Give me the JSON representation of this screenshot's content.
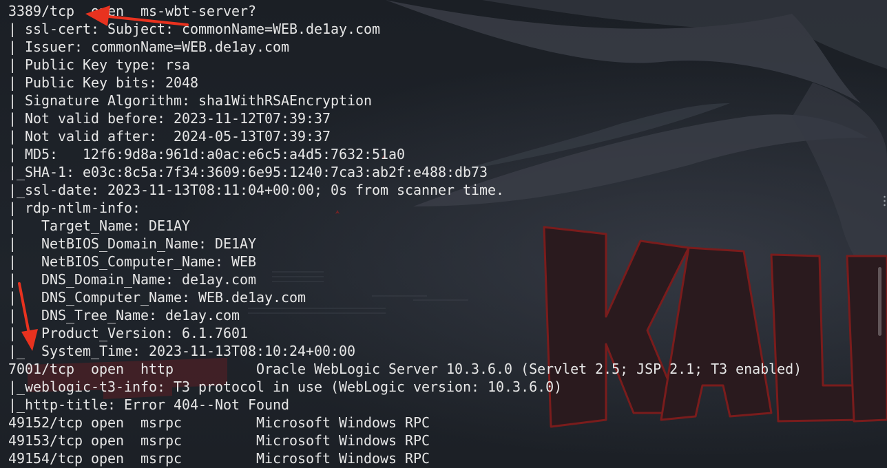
{
  "terminal": {
    "lines": [
      "3389/tcp  open  ms-wbt-server?",
      "| ssl-cert: Subject: commonName=WEB.de1ay.com",
      "| Issuer: commonName=WEB.de1ay.com",
      "| Public Key type: rsa",
      "| Public Key bits: 2048",
      "| Signature Algorithm: sha1WithRSAEncryption",
      "| Not valid before: 2023-11-12T07:39:37",
      "| Not valid after:  2024-05-13T07:39:37",
      "| MD5:   12f6:9d8a:961d:a0ac:e6c5:a4d5:7632:51a0",
      "|_SHA-1: e03c:8c5a:7f34:3609:6e95:1240:7ca3:ab2f:e488:db73",
      "|_ssl-date: 2023-11-13T08:11:04+00:00; 0s from scanner time.",
      "| rdp-ntlm-info:",
      "|   Target_Name: DE1AY",
      "|   NetBIOS_Domain_Name: DE1AY",
      "|   NetBIOS_Computer_Name: WEB",
      "|   DNS_Domain_Name: de1ay.com",
      "|   DNS_Computer_Name: WEB.de1ay.com",
      "|   DNS_Tree_Name: de1ay.com",
      "|   Product_Version: 6.1.7601",
      "|_  System_Time: 2023-11-13T08:10:24+00:00",
      "7001/tcp  open  http          Oracle WebLogic Server 10.3.6.0 (Servlet 2.5; JSP 2.1; T3 enabled)",
      "|_weblogic-t3-info: T3 protocol in use (WebLogic version: 10.3.6.0)",
      "|_http-title: Error 404--Not Found",
      "49152/tcp open  msrpc         Microsoft Windows RPC",
      "49153/tcp open  msrpc         Microsoft Windows RPC",
      "49154/tcp open  msrpc         Microsoft Windows RPC"
    ]
  },
  "colors": {
    "background": "#1d2127",
    "text": "#e6e6e6",
    "annotation_arrow": "#e8321f",
    "logo_red": "#7a1c1c"
  },
  "icons": {
    "annotations": "red-arrow-icon",
    "wallpaper": "kali-dragon-logo"
  }
}
